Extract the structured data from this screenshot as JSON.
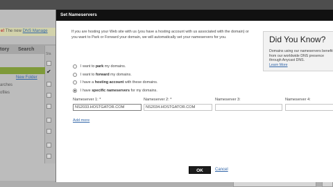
{
  "background": {
    "notice": {
      "prefix": "e!",
      "middle": " The new ",
      "link": "DNS Manage"
    },
    "tabs": [
      "tory",
      "Search"
    ],
    "column_header": "Sta",
    "new_folder": "New Folder",
    "sidebar_items": [
      "arches",
      "ofiles"
    ]
  },
  "dialog": {
    "title": "Set Nameservers",
    "intro": "If you are hosting your Web site with us (you have a hosting account with us associated with the domain) or you want to Park or Forward your domain, we will automatically set your nameservers for you.",
    "options": [
      {
        "prefix": "I want to ",
        "bold": "park",
        "suffix": " my domains.",
        "selected": false
      },
      {
        "prefix": "I want to ",
        "bold": "forward",
        "suffix": " my domains.",
        "selected": false
      },
      {
        "prefix": "I have a ",
        "bold": "hosting account",
        "suffix": " with these domains.",
        "selected": false
      },
      {
        "prefix": "I have ",
        "bold": "specific nameservers",
        "suffix": " for my domains.",
        "selected": true
      }
    ],
    "nameservers": [
      {
        "label": "Nameserver 1: *",
        "value": "NS2033.HOSTGATOR.COM"
      },
      {
        "label": "Nameserver 2: *",
        "value": "NS2034.HOSTGATOR.COM"
      },
      {
        "label": "Nameserver 3:",
        "value": ""
      },
      {
        "label": "Nameserver 4:",
        "value": ""
      }
    ],
    "add_more": "Add more",
    "ok": "OK",
    "cancel": "Cancel"
  },
  "did_you_know": {
    "title": "Did You Know?",
    "body": "Domains using our nameservers benefit from our worldwide DNS presence through Anycast DNS.",
    "link": "Learn More"
  },
  "colors": {
    "header": "#111111",
    "link": "#3266a8",
    "ok_button": "#1d1d1d",
    "sidebar_selected": "#7f9a3a"
  }
}
